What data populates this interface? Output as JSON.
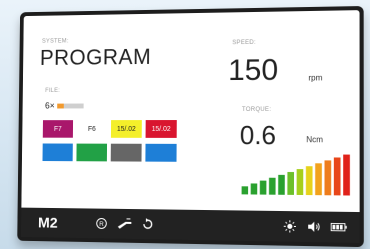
{
  "system": {
    "label": "SYSTEM:",
    "value": "PROGRAM"
  },
  "file": {
    "label": "FILE:",
    "count": "6×",
    "progress": 0.25,
    "progress_color": "#f29a2e"
  },
  "speed": {
    "label": "SPEED:",
    "value": "150",
    "unit": "rpm"
  },
  "torque": {
    "label": "TORQUE:",
    "value": "0.6",
    "unit": "Ncm"
  },
  "files": [
    {
      "label": "F7",
      "color": "#a9176b",
      "text_color": "#ffffff"
    },
    {
      "label": "F6",
      "color": "#ffffff",
      "text_color": "#222222"
    },
    {
      "label": "15/.02",
      "color": "#f4ef2a",
      "text_color": "#222222"
    },
    {
      "label": "15/.02",
      "color": "#d9152f",
      "text_color": "#ffffff"
    },
    {
      "label": "",
      "color": "#1e7fd7"
    },
    {
      "label": "",
      "color": "#22a146"
    },
    {
      "label": "",
      "color": "#666666"
    },
    {
      "label": "",
      "color": "#1e7fd7"
    }
  ],
  "torque_scale": {
    "levels": 12,
    "colors": [
      "#2aa12f",
      "#2aa12f",
      "#2aa12f",
      "#2aa12f",
      "#2aa12f",
      "#6cc02a",
      "#a6cf1c",
      "#e7d21b",
      "#f2a21c",
      "#ee7d1c",
      "#e8461a",
      "#e0221a"
    ]
  },
  "bottom_bar": {
    "mode": "M2",
    "icons": [
      "registered-icon",
      "foot-pedal-icon",
      "rotate-icon",
      "brightness-icon",
      "volume-icon",
      "battery-icon"
    ]
  }
}
